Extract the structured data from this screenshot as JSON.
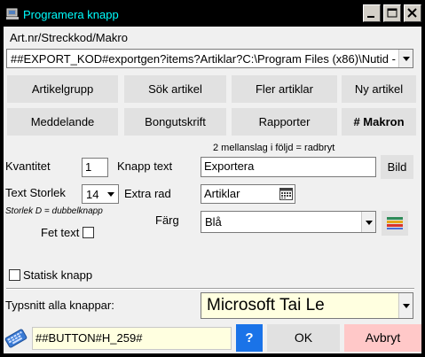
{
  "window": {
    "title": "Programera knapp"
  },
  "top": {
    "label": "Art.nr/Streckkod/Makro",
    "combo_value": "##EXPORT_KOD#exportgen?items?Artiklar?C:\\Program Files (x86)\\Nutid -"
  },
  "buttons_row1": [
    "Artikelgrupp",
    "Sök artikel",
    "Fler artiklar",
    "Ny artikel"
  ],
  "buttons_row2": [
    "Meddelande",
    "Bongutskrift",
    "Rapporter",
    "# Makron"
  ],
  "form": {
    "hint": "2 mellanslag i följd = radbryt",
    "kvantitet_label": "Kvantitet",
    "kvantitet_value": "1",
    "knapp_text_label": "Knapp text",
    "knapp_text_value": "Exportera",
    "bild_button": "Bild",
    "text_storlek_label": "Text Storlek",
    "text_storlek_value": "14",
    "extra_rad_label": "Extra rad",
    "extra_rad_value": "Artiklar",
    "storlek_note": "Storlek D = dubbelknapp",
    "farg_label": "Färg",
    "farg_value": "Blå",
    "fet_text_label": "Fet text",
    "statisk_label": "Statisk knapp"
  },
  "font_row": {
    "label": "Typsnitt alla knappar:",
    "value": "Microsoft Tai Le"
  },
  "bottom": {
    "code_value": "##BUTTON#H_259#",
    "help_label": "?",
    "ok_label": "OK",
    "cancel_label": "Avbryt"
  },
  "colors": {
    "title_text": "#00ffff",
    "selected_tab_text": "#000000",
    "help_button": "#1a73e8",
    "cancel_button": "#ffc8c8",
    "font_combo_bg": "#ffffe0",
    "code_input_bg": "#ffffe0"
  },
  "icons": {
    "app": "app-icon",
    "minimize": "minimize-icon",
    "maximize": "maximize-icon",
    "close": "close-icon",
    "calendar": "calendar-icon",
    "color_palette": "color-palette-icon",
    "keyboard": "keyboard-icon"
  }
}
